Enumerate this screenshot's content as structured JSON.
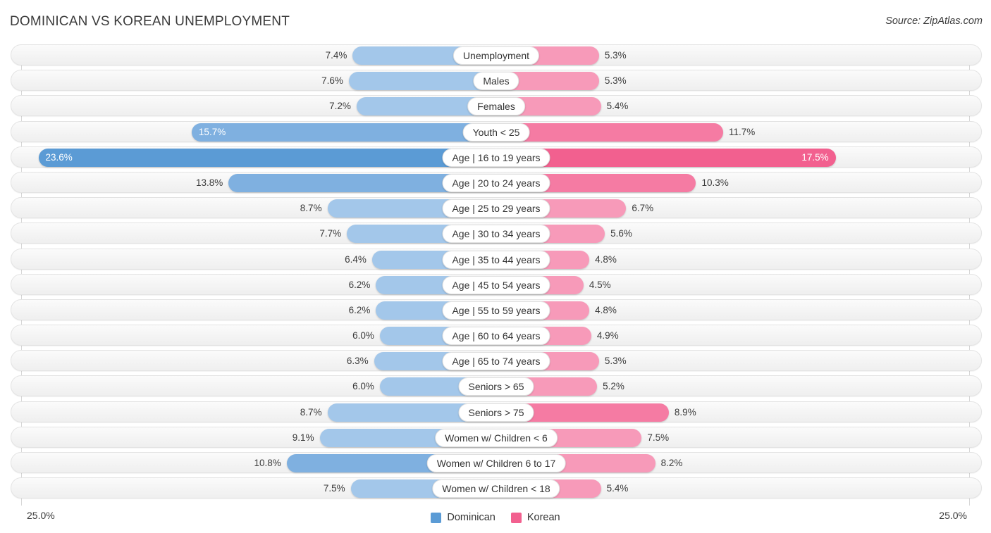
{
  "header": {
    "title": "DOMINICAN VS KOREAN UNEMPLOYMENT",
    "source": "Source: ZipAtlas.com"
  },
  "axis": {
    "left_max_label": "25.0%",
    "right_max_label": "25.0%"
  },
  "legend": {
    "items": [
      {
        "label": "Dominican",
        "color": "#5b9bd5"
      },
      {
        "label": "Korean",
        "color": "#f2608f"
      }
    ]
  },
  "colors": {
    "blue_light": "#a3c7ea",
    "blue_mid": "#7fb0e0",
    "blue_dark": "#5b9bd5",
    "pink_light": "#f79ab9",
    "pink_mid": "#f57ba3",
    "pink_dark": "#f2608f",
    "track": "#f4f4f4",
    "text": "#3c3c3c"
  },
  "chart_data": {
    "type": "bar",
    "orientation": "diverging-horizontal",
    "title": "DOMINICAN VS KOREAN UNEMPLOYMENT",
    "xlabel": "",
    "ylabel": "",
    "xlim": [
      0,
      25
    ],
    "axis_max": 25.0,
    "grid": false,
    "legend_position": "bottom-center",
    "categories": [
      "Unemployment",
      "Males",
      "Females",
      "Youth < 25",
      "Age | 16 to 19 years",
      "Age | 20 to 24 years",
      "Age | 25 to 29 years",
      "Age | 30 to 34 years",
      "Age | 35 to 44 years",
      "Age | 45 to 54 years",
      "Age | 55 to 59 years",
      "Age | 60 to 64 years",
      "Age | 65 to 74 years",
      "Seniors > 65",
      "Seniors > 75",
      "Women w/ Children < 6",
      "Women w/ Children 6 to 17",
      "Women w/ Children < 18"
    ],
    "series": [
      {
        "name": "Dominican",
        "side": "left",
        "values": [
          7.4,
          7.6,
          7.2,
          15.7,
          23.6,
          13.8,
          8.7,
          7.7,
          6.4,
          6.2,
          6.2,
          6.0,
          6.3,
          6.0,
          8.7,
          9.1,
          10.8,
          7.5
        ],
        "labels": [
          "7.4%",
          "7.6%",
          "7.2%",
          "15.7%",
          "23.6%",
          "13.8%",
          "8.7%",
          "7.7%",
          "6.4%",
          "6.2%",
          "6.2%",
          "6.0%",
          "6.3%",
          "6.0%",
          "8.7%",
          "9.1%",
          "10.8%",
          "7.5%"
        ]
      },
      {
        "name": "Korean",
        "side": "right",
        "values": [
          5.3,
          5.3,
          5.4,
          11.7,
          17.5,
          10.3,
          6.7,
          5.6,
          4.8,
          4.5,
          4.8,
          4.9,
          5.3,
          5.2,
          8.9,
          7.5,
          8.2,
          5.4
        ],
        "labels": [
          "5.3%",
          "5.3%",
          "5.4%",
          "11.7%",
          "17.5%",
          "10.3%",
          "6.7%",
          "5.6%",
          "4.8%",
          "4.5%",
          "4.8%",
          "4.9%",
          "5.3%",
          "5.2%",
          "8.9%",
          "7.5%",
          "8.2%",
          "5.4%"
        ]
      }
    ]
  },
  "rows": [
    {
      "label": "Unemployment",
      "left": "7.4%",
      "right": "5.3%",
      "lv": 7.4,
      "rv": 5.3,
      "lshade": "light",
      "rshade": "light",
      "lin": false,
      "rin": false
    },
    {
      "label": "Males",
      "left": "7.6%",
      "right": "5.3%",
      "lv": 7.6,
      "rv": 5.3,
      "lshade": "light",
      "rshade": "light",
      "lin": false,
      "rin": false
    },
    {
      "label": "Females",
      "left": "7.2%",
      "right": "5.4%",
      "lv": 7.2,
      "rv": 5.4,
      "lshade": "light",
      "rshade": "light",
      "lin": false,
      "rin": false
    },
    {
      "label": "Youth < 25",
      "left": "15.7%",
      "right": "11.7%",
      "lv": 15.7,
      "rv": 11.7,
      "lshade": "mid",
      "rshade": "mid",
      "lin": true,
      "rin": false
    },
    {
      "label": "Age | 16 to 19 years",
      "left": "23.6%",
      "right": "17.5%",
      "lv": 23.6,
      "rv": 17.5,
      "lshade": "dark",
      "rshade": "dark",
      "lin": true,
      "rin": true
    },
    {
      "label": "Age | 20 to 24 years",
      "left": "13.8%",
      "right": "10.3%",
      "lv": 13.8,
      "rv": 10.3,
      "lshade": "mid",
      "rshade": "mid",
      "lin": false,
      "rin": false
    },
    {
      "label": "Age | 25 to 29 years",
      "left": "8.7%",
      "right": "6.7%",
      "lv": 8.7,
      "rv": 6.7,
      "lshade": "light",
      "rshade": "light",
      "lin": false,
      "rin": false
    },
    {
      "label": "Age | 30 to 34 years",
      "left": "7.7%",
      "right": "5.6%",
      "lv": 7.7,
      "rv": 5.6,
      "lshade": "light",
      "rshade": "light",
      "lin": false,
      "rin": false
    },
    {
      "label": "Age | 35 to 44 years",
      "left": "6.4%",
      "right": "4.8%",
      "lv": 6.4,
      "rv": 4.8,
      "lshade": "light",
      "rshade": "light",
      "lin": false,
      "rin": false
    },
    {
      "label": "Age | 45 to 54 years",
      "left": "6.2%",
      "right": "4.5%",
      "lv": 6.2,
      "rv": 4.5,
      "lshade": "light",
      "rshade": "light",
      "lin": false,
      "rin": false
    },
    {
      "label": "Age | 55 to 59 years",
      "left": "6.2%",
      "right": "4.8%",
      "lv": 6.2,
      "rv": 4.8,
      "lshade": "light",
      "rshade": "light",
      "lin": false,
      "rin": false
    },
    {
      "label": "Age | 60 to 64 years",
      "left": "6.0%",
      "right": "4.9%",
      "lv": 6.0,
      "rv": 4.9,
      "lshade": "light",
      "rshade": "light",
      "lin": false,
      "rin": false
    },
    {
      "label": "Age | 65 to 74 years",
      "left": "6.3%",
      "right": "5.3%",
      "lv": 6.3,
      "rv": 5.3,
      "lshade": "light",
      "rshade": "light",
      "lin": false,
      "rin": false
    },
    {
      "label": "Seniors > 65",
      "left": "6.0%",
      "right": "5.2%",
      "lv": 6.0,
      "rv": 5.2,
      "lshade": "light",
      "rshade": "light",
      "lin": false,
      "rin": false
    },
    {
      "label": "Seniors > 75",
      "left": "8.7%",
      "right": "8.9%",
      "lv": 8.7,
      "rv": 8.9,
      "lshade": "light",
      "rshade": "mid",
      "lin": false,
      "rin": false
    },
    {
      "label": "Women w/ Children < 6",
      "left": "9.1%",
      "right": "7.5%",
      "lv": 9.1,
      "rv": 7.5,
      "lshade": "light",
      "rshade": "light",
      "lin": false,
      "rin": false
    },
    {
      "label": "Women w/ Children 6 to 17",
      "left": "10.8%",
      "right": "8.2%",
      "lv": 10.8,
      "rv": 8.2,
      "lshade": "mid",
      "rshade": "light",
      "lin": false,
      "rin": false
    },
    {
      "label": "Women w/ Children < 18",
      "left": "7.5%",
      "right": "5.4%",
      "lv": 7.5,
      "rv": 5.4,
      "lshade": "light",
      "rshade": "light",
      "lin": false,
      "rin": false
    }
  ]
}
